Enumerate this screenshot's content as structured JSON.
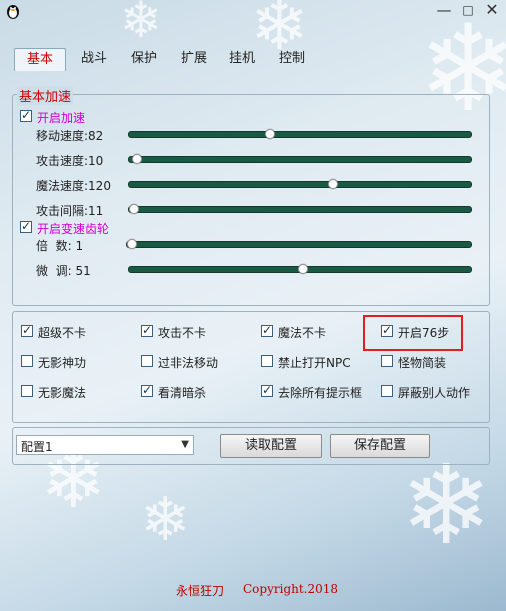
{
  "window": {
    "minimize": "—",
    "maximize": "□",
    "close": "✕"
  },
  "tabs": [
    "基本",
    "战斗",
    "保护",
    "扩展",
    "挂机",
    "控制"
  ],
  "basic_group": {
    "legend": "基本加速",
    "enable_speed": {
      "label": "开启加速",
      "checked": true
    },
    "sliders": [
      {
        "label": "移动速度:82",
        "value": 0.41
      },
      {
        "label": "攻击速度:10",
        "value": 0.01
      },
      {
        "label": "魔法速度:120",
        "value": 0.6
      },
      {
        "label": "攻击间隔:11",
        "value": 0.0
      }
    ],
    "enable_gear": {
      "label": "开启变速齿轮",
      "checked": true
    },
    "gear_sliders": [
      {
        "label": "倍  数: 1",
        "value": 0.0
      },
      {
        "label": "微  调: 51",
        "value": 0.51
      }
    ]
  },
  "options": [
    {
      "label": "超级不卡",
      "checked": true
    },
    {
      "label": "攻击不卡",
      "checked": true
    },
    {
      "label": "魔法不卡",
      "checked": true
    },
    {
      "label": "开启76步",
      "checked": true
    },
    {
      "label": "无影神功",
      "checked": false
    },
    {
      "label": "过非法移动",
      "checked": false
    },
    {
      "label": "禁止打开NPC",
      "checked": false
    },
    {
      "label": "怪物简装",
      "checked": false
    },
    {
      "label": "无影魔法",
      "checked": false
    },
    {
      "label": "看清暗杀",
      "checked": true
    },
    {
      "label": "去除所有提示框",
      "checked": true
    },
    {
      "label": "屏蔽别人动作",
      "checked": false
    }
  ],
  "config": {
    "selected": "配置1",
    "read_label": "读取配置",
    "save_label": "保存配置"
  },
  "footer": {
    "brand": "永恒狂刀",
    "copyright": "Copyright.2018"
  },
  "colors": {
    "track": "#1a5a44",
    "highlight": "#e02020",
    "magenta": "#d000d0"
  }
}
